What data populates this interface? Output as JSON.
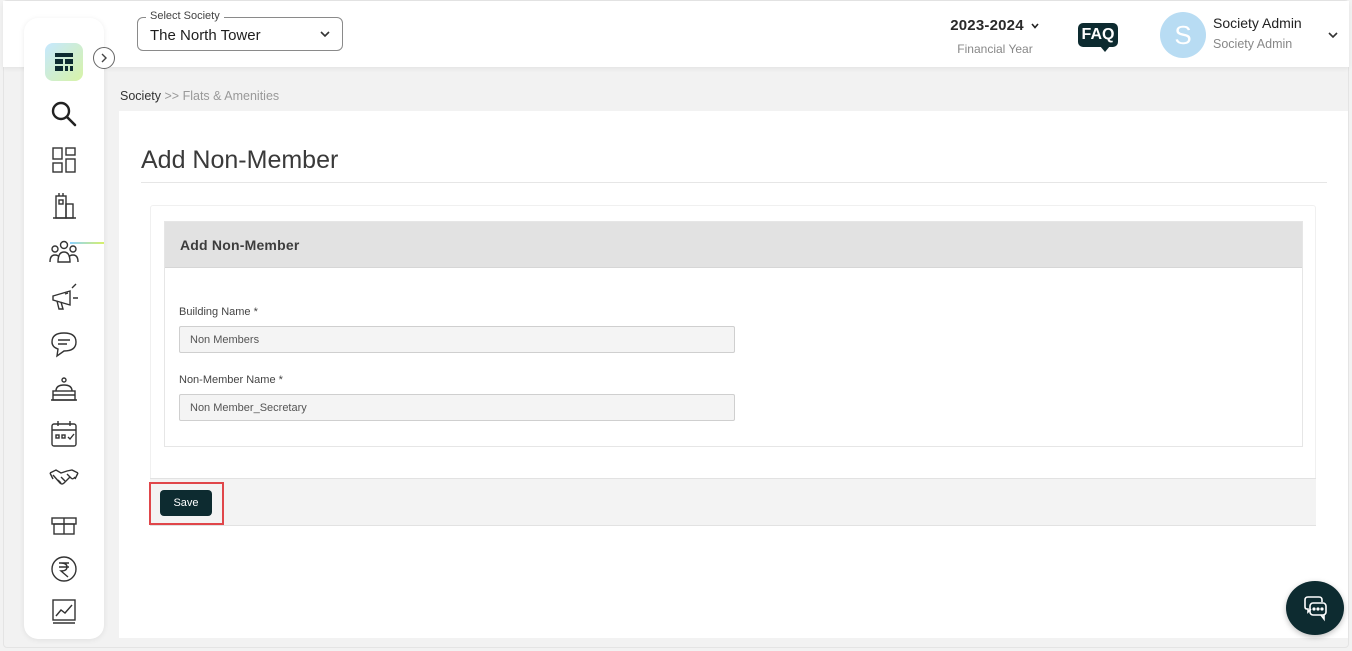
{
  "header": {
    "society_select": {
      "label": "Select Society",
      "value": "The North Tower"
    },
    "financial_year": {
      "value": "2023-2024",
      "label": "Financial Year"
    },
    "faq_label": "FAQ",
    "user": {
      "initial": "S",
      "name": "Society Admin",
      "role": "Society Admin"
    }
  },
  "sidebar": {
    "icons": [
      "search-icon",
      "dashboard-icon",
      "building-icon",
      "members-icon",
      "announcement-icon",
      "chat-icon",
      "facility-icon",
      "calendar-icon",
      "handshake-icon",
      "gift-icon",
      "rupee-icon",
      "report-chart-icon"
    ],
    "active": "building-icon"
  },
  "breadcrumb": {
    "root": "Society",
    "separator": ">>",
    "current": "Flats & Amenities"
  },
  "page": {
    "title": "Add Non-Member",
    "card_title": "Add Non-Member",
    "fields": {
      "building_name": {
        "label": "Building Name *",
        "value": "Non Members"
      },
      "non_member_name": {
        "label": "Non-Member Name *",
        "value": "Non Member_Secretary"
      }
    },
    "save_label": "Save"
  },
  "colors": {
    "primary_dark": "#0d2b30",
    "highlight": "#e0464a",
    "avatar": "#b8dcf3"
  }
}
